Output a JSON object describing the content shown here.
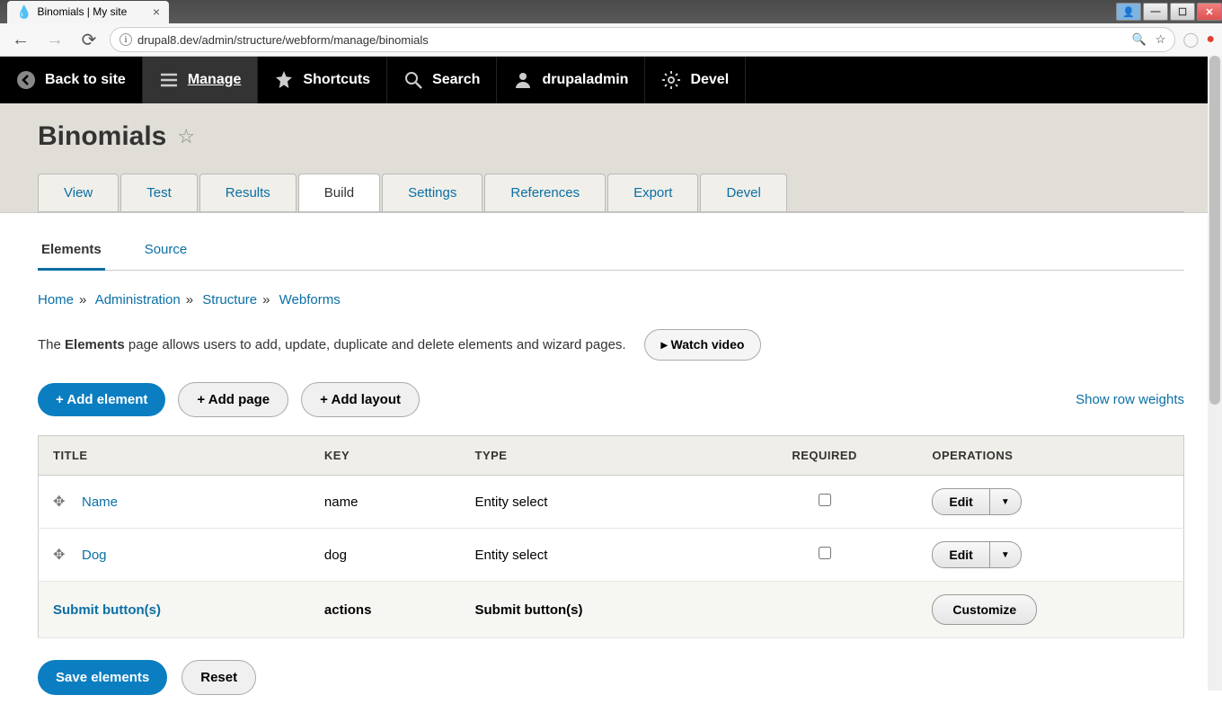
{
  "browser": {
    "tab_title": "Binomials | My site",
    "url": "drupal8.dev/admin/structure/webform/manage/binomials"
  },
  "toolbar": {
    "back_to_site": "Back to site",
    "manage": "Manage",
    "shortcuts": "Shortcuts",
    "search": "Search",
    "user": "drupaladmin",
    "devel": "Devel"
  },
  "page": {
    "title": "Binomials"
  },
  "primary_tabs": [
    "View",
    "Test",
    "Results",
    "Build",
    "Settings",
    "References",
    "Export",
    "Devel"
  ],
  "secondary_tabs": [
    "Elements",
    "Source"
  ],
  "breadcrumb": [
    "Home",
    "Administration",
    "Structure",
    "Webforms"
  ],
  "help": {
    "prefix": "The ",
    "strong": "Elements",
    "suffix": " page allows users to add, update, duplicate and delete elements and wizard pages.",
    "watch": "▸ Watch video"
  },
  "actions": {
    "add_element": "+ Add element",
    "add_page": "+ Add page",
    "add_layout": "+ Add layout",
    "show_weights": "Show row weights"
  },
  "table": {
    "headers": {
      "title": "TITLE",
      "key": "KEY",
      "type": "TYPE",
      "required": "REQUIRED",
      "operations": "OPERATIONS"
    },
    "rows": [
      {
        "title": "Name",
        "key": "name",
        "type": "Entity select",
        "required": false,
        "op": "Edit"
      },
      {
        "title": "Dog",
        "key": "dog",
        "type": "Entity select",
        "required": false,
        "op": "Edit"
      }
    ],
    "submit_row": {
      "title": "Submit button(s)",
      "key": "actions",
      "type": "Submit button(s)",
      "op": "Customize"
    }
  },
  "form_actions": {
    "save": "Save elements",
    "reset": "Reset"
  }
}
